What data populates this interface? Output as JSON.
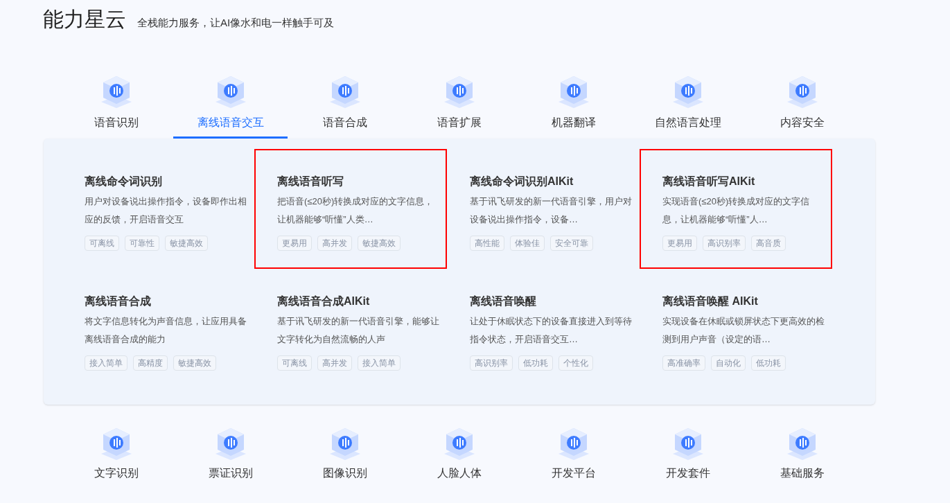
{
  "header": {
    "title": "能力星云",
    "subtitle": "全栈能力服务，让AI像水和电一样触手可及"
  },
  "tabs": [
    {
      "label": "语音识别",
      "selected": false
    },
    {
      "label": "离线语音交互",
      "selected": true
    },
    {
      "label": "语音合成",
      "selected": false
    },
    {
      "label": "语音扩展",
      "selected": false
    },
    {
      "label": "机器翻译",
      "selected": false
    },
    {
      "label": "自然语言处理",
      "selected": false
    },
    {
      "label": "内容安全",
      "selected": false
    }
  ],
  "cards": [
    {
      "title": "离线命令词识别",
      "description": "用户对设备说出操作指令，设备即作出相应的反馈，开启语音交互",
      "tags": [
        "可离线",
        "可靠性",
        "敏捷高效"
      ],
      "highlighted": false
    },
    {
      "title": "离线语音听写",
      "description": "把语音(≤20秒)转换成对应的文字信息，让机器能够“听懂”人类…",
      "tags": [
        "更易用",
        "高并发",
        "敏捷高效"
      ],
      "highlighted": true
    },
    {
      "title": "离线命令词识别AIKit",
      "description": "基于讯飞研发的新一代语音引擎，用户对设备说出操作指令，设备…",
      "tags": [
        "高性能",
        "体验佳",
        "安全可靠"
      ],
      "highlighted": false
    },
    {
      "title": "离线语音听写AIKit",
      "description": "实现语音(≤20秒)转换成对应的文字信息，让机器能够“听懂”人…",
      "tags": [
        "更易用",
        "高识别率",
        "高音质"
      ],
      "highlighted": true
    },
    {
      "title": "离线语音合成",
      "description": "将文字信息转化为声音信息，让应用具备离线语音合成的能力",
      "tags": [
        "接入简单",
        "高精度",
        "敏捷高效"
      ],
      "highlighted": false
    },
    {
      "title": "离线语音合成AIKit",
      "description": "基于讯飞研发的新一代语音引擎，能够让文字转化为自然流畅的人声",
      "tags": [
        "可离线",
        "高并发",
        "接入简单"
      ],
      "highlighted": false
    },
    {
      "title": "离线语音唤醒",
      "description": "让处于休眠状态下的设备直接进入到等待指令状态，开启语音交互…",
      "tags": [
        "高识别率",
        "低功耗",
        "个性化"
      ],
      "highlighted": false
    },
    {
      "title": "离线语音唤醒 AIKit",
      "description": "实现设备在休眠或锁屏状态下更高效的检测到用户声音（设定的语…",
      "tags": [
        "高准确率",
        "自动化",
        "低功耗"
      ],
      "highlighted": false
    }
  ],
  "bottom_tabs": [
    {
      "label": "文字识别"
    },
    {
      "label": "票证识别"
    },
    {
      "label": "图像识别"
    },
    {
      "label": "人脸人体"
    },
    {
      "label": "开发平台"
    },
    {
      "label": "开发套件"
    },
    {
      "label": "基础服务"
    }
  ]
}
